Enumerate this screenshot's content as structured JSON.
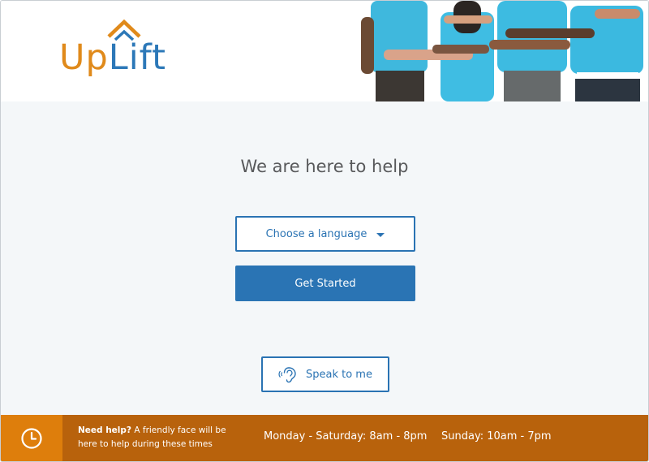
{
  "brand": {
    "name_part1": "Up",
    "name_part2": "Lift"
  },
  "header": {
    "photo_alt": "Group of people in matching blue shirts with arms around each other"
  },
  "main": {
    "headline": "We are here to help",
    "language_select": {
      "label": "Choose a language"
    },
    "get_started_label": "Get Started",
    "speak_label": "Speak to me"
  },
  "footer": {
    "help_bold": "Need help?",
    "help_text": " A friendly face will be here to help during these times",
    "hours_weekday": "Monday - Saturday: 8am - 8pm",
    "hours_sunday": "Sunday: 10am - 7pm"
  },
  "colors": {
    "brand_orange": "#e08a1b",
    "brand_blue": "#2a74b4",
    "footer_dark": "#b8620c",
    "footer_light": "#de7e0c",
    "page_bg": "#f4f7f9"
  },
  "icons": {
    "logo_roof": "house-roof-icon",
    "caret": "chevron-down-icon",
    "ear": "ear-sound-icon",
    "clock": "clock-icon"
  }
}
